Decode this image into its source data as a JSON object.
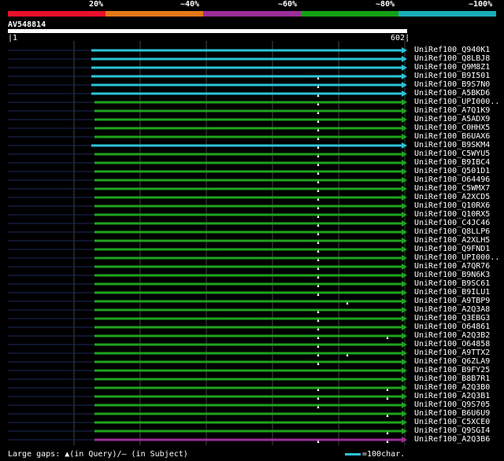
{
  "legend": {
    "colors": [
      "#e8102a",
      "#e27818",
      "#9b2d98",
      "#14a014",
      "#1aaeb8"
    ],
    "labels": [
      "20%",
      "~40%",
      "~60%",
      "~80%",
      "~100%"
    ]
  },
  "query": {
    "name": "AV548814",
    "start": "1",
    "end": "602"
  },
  "footer": {
    "text": "Large gaps: ▲(in Query)/— (in Subject)",
    "scale_label": "=100char."
  },
  "hits": [
    {
      "name": "UniRef100_Q940K1",
      "color": "#2bc4d8",
      "marks": []
    },
    {
      "name": "UniRef100_Q8LBJ8",
      "color": "#2bc4d8",
      "marks": []
    },
    {
      "name": "UniRef100_Q9M8Z1",
      "color": "#2bc4d8",
      "marks": []
    },
    {
      "name": "UniRef100_B9I501",
      "color": "#2bc4d8",
      "marks": [
        1
      ]
    },
    {
      "name": "UniRef100_B9S7N0",
      "color": "#2bc4d8",
      "marks": [
        1
      ]
    },
    {
      "name": "UniRef100_A5BKD6",
      "color": "#2bc4d8",
      "marks": [
        1
      ]
    },
    {
      "name": "UniRef100_UPI000..",
      "color": "#1ea41e",
      "marks": [
        1
      ]
    },
    {
      "name": "UniRef100_A7Q1K9",
      "color": "#1ea41e",
      "marks": [
        1
      ]
    },
    {
      "name": "UniRef100_A5ADX9",
      "color": "#1ea41e",
      "marks": [
        1
      ]
    },
    {
      "name": "UniRef100_C0HHX5",
      "color": "#1ea41e",
      "marks": [
        1
      ]
    },
    {
      "name": "UniRef100_B6UAX6",
      "color": "#1ea41e",
      "marks": [
        1
      ]
    },
    {
      "name": "UniRef100_B9SKM4",
      "color": "#2bc4d8",
      "marks": [
        1
      ]
    },
    {
      "name": "UniRef100_C5WYU5",
      "color": "#1ea41e",
      "marks": [
        1
      ]
    },
    {
      "name": "UniRef100_B9IBC4",
      "color": "#1ea41e",
      "marks": [
        1
      ]
    },
    {
      "name": "UniRef100_Q501D1",
      "color": "#1ea41e",
      "marks": [
        1
      ]
    },
    {
      "name": "UniRef100_O64496",
      "color": "#1ea41e",
      "marks": [
        1
      ]
    },
    {
      "name": "UniRef100_C5WMX7",
      "color": "#1ea41e",
      "marks": [
        1
      ]
    },
    {
      "name": "UniRef100_A2XCD5",
      "color": "#1ea41e",
      "marks": [
        1
      ]
    },
    {
      "name": "UniRef100_Q10RX6",
      "color": "#1ea41e",
      "marks": [
        1
      ]
    },
    {
      "name": "UniRef100_Q10RX5",
      "color": "#1ea41e",
      "marks": [
        1
      ]
    },
    {
      "name": "UniRef100_C4JC46",
      "color": "#1ea41e",
      "marks": [
        1
      ]
    },
    {
      "name": "UniRef100_Q8LLP6",
      "color": "#1ea41e",
      "marks": [
        1
      ]
    },
    {
      "name": "UniRef100_A2XLH5",
      "color": "#1ea41e",
      "marks": [
        1
      ]
    },
    {
      "name": "UniRef100_Q9FND1",
      "color": "#1ea41e",
      "marks": [
        1
      ]
    },
    {
      "name": "UniRef100_UPI000..",
      "color": "#1ea41e",
      "marks": [
        1
      ]
    },
    {
      "name": "UniRef100_A7QR76",
      "color": "#1ea41e",
      "marks": [
        1
      ]
    },
    {
      "name": "UniRef100_B9N6K3",
      "color": "#1ea41e",
      "marks": [
        1
      ]
    },
    {
      "name": "UniRef100_B9SC61",
      "color": "#1ea41e",
      "marks": [
        1
      ]
    },
    {
      "name": "UniRef100_B9ILU1",
      "color": "#1ea41e",
      "marks": [
        1
      ]
    },
    {
      "name": "UniRef100_A9TBP9",
      "color": "#1ea41e",
      "marks": [
        2
      ]
    },
    {
      "name": "UniRef100_A2Q3A8",
      "color": "#1ea41e",
      "marks": [
        1
      ]
    },
    {
      "name": "UniRef100_Q3EBG3",
      "color": "#1ea41e",
      "marks": [
        1
      ]
    },
    {
      "name": "UniRef100_O64861",
      "color": "#1ea41e",
      "marks": [
        1
      ]
    },
    {
      "name": "UniRef100_A2Q3B2",
      "color": "#1ea41e",
      "marks": [
        1,
        3
      ]
    },
    {
      "name": "UniRef100_O64858",
      "color": "#1ea41e",
      "marks": [
        1
      ]
    },
    {
      "name": "UniRef100_A9TTX2",
      "color": "#1ea41e",
      "marks": [
        1,
        2
      ]
    },
    {
      "name": "UniRef100_Q6ZLA9",
      "color": "#1ea41e",
      "marks": [
        1
      ]
    },
    {
      "name": "UniRef100_B9FY25",
      "color": "#1ea41e",
      "marks": []
    },
    {
      "name": "UniRef100_B8B7R1",
      "color": "#1ea41e",
      "marks": []
    },
    {
      "name": "UniRef100_A2Q3B0",
      "color": "#1ea41e",
      "marks": [
        1,
        3
      ]
    },
    {
      "name": "UniRef100_A2Q3B1",
      "color": "#1ea41e",
      "marks": [
        1,
        3
      ]
    },
    {
      "name": "UniRef100_Q9S705",
      "color": "#1ea41e",
      "marks": [
        1
      ]
    },
    {
      "name": "UniRef100_B6U6U9",
      "color": "#1ea41e",
      "marks": [
        3
      ]
    },
    {
      "name": "UniRef100_C5XCE0",
      "color": "#1ea41e",
      "marks": []
    },
    {
      "name": "UniRef100_Q9SGI4",
      "color": "#1ea41e",
      "marks": [
        3
      ]
    },
    {
      "name": "UniRef100_A2Q3B6",
      "color": "#9b2d98",
      "marks": [
        1,
        3
      ]
    }
  ]
}
